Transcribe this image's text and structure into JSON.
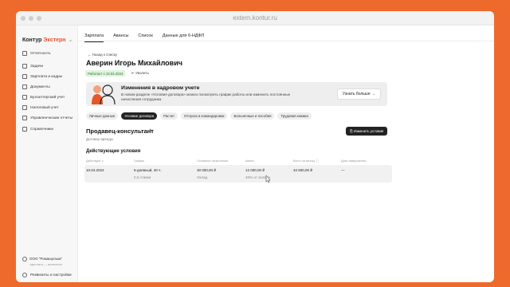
{
  "window": {
    "url": "extern.kontur.ru"
  },
  "sidebar": {
    "brand": {
      "name": "Контур",
      "accent": "Экстерн",
      "chevron": "⌄"
    },
    "items": [
      {
        "label": "Отчетность",
        "icon": "flag-icon"
      },
      {
        "label": "Задачи",
        "icon": "tasks-icon"
      },
      {
        "label": "Зарплата и кадры",
        "icon": "salary-icon"
      },
      {
        "label": "Документы",
        "icon": "documents-icon"
      },
      {
        "label": "Бухгалтерский учет",
        "icon": "accounting-icon"
      },
      {
        "label": "Налоговый учет",
        "icon": "tax-icon"
      },
      {
        "label": "Управленческие отчеты",
        "icon": "reports-icon"
      },
      {
        "label": "Справочники",
        "icon": "reference-icon"
      }
    ],
    "org": {
      "name": "ООО \"Ромашулька\"",
      "sub": "зарплата — включено"
    },
    "settings": "Реквизиты и настройки"
  },
  "topnav": [
    "Зарплата",
    "Авансы",
    "Список",
    "Данные для 6-НДФЛ"
  ],
  "employee": {
    "back": "← Назад к списку",
    "name": "Аверин Игорь Михайлович",
    "status": "Работает с 10.04.2024",
    "fire": "⇤ Уволить"
  },
  "banner": {
    "title": "Изменения в кадровом учете",
    "text": "В новом разделе «Условия договора» можно посмотреть график работы или изменить постоянные начисления сотрудника",
    "button": "Узнать больше  →"
  },
  "subtabs": [
    {
      "label": "Личные данные",
      "active": false
    },
    {
      "label": "Условие договора",
      "active": true
    },
    {
      "label": "Расчет",
      "active": false
    },
    {
      "label": "Отпуска и командировки",
      "active": false
    },
    {
      "label": "Больничные и пособия",
      "active": false
    },
    {
      "label": "Трудовая книжка",
      "active": false
    }
  ],
  "position": {
    "title": "Продавец-консультант",
    "edit_icon": "✎",
    "contract": "Договор аренды",
    "change_button": "⎘ Изменить условия"
  },
  "conditions": {
    "title": "Действующие условия",
    "headers": [
      "Действуют с",
      "График",
      "Основное начисление",
      "Аванс",
      "Всего за месяц ⓘ",
      "Дата завершения"
    ],
    "row": {
      "date": "10.04.2024",
      "schedule": "5-дневный, 40 ч.",
      "schedule_sub": "0,5 ставки",
      "salary": "30 000,00 ₽",
      "salary_sub": "Оклад",
      "advance": "12 000,00 ₽",
      "advance_sub": "40% от оклада",
      "total": "34 500,00 ₽",
      "end": "—"
    }
  },
  "colors": {
    "background": "#ee6a2c",
    "brand_accent": "#e8552a",
    "status_green": "#2a7a2a"
  }
}
